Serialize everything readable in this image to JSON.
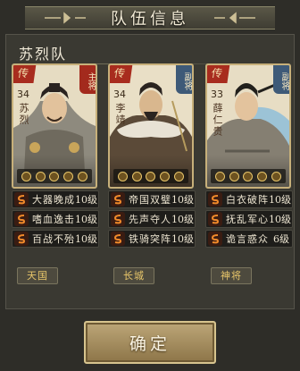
{
  "header": {
    "title": "队伍信息"
  },
  "team": {
    "name": "苏烈队"
  },
  "generals": [
    {
      "seal": "传",
      "rank": "主将",
      "level": "34",
      "name": "苏烈",
      "skills": [
        {
          "name": "大器晚成",
          "level": "10级"
        },
        {
          "name": "嗜血逸击",
          "level": "10级"
        },
        {
          "name": "百战不殆",
          "level": "10级"
        }
      ],
      "tag": "天国"
    },
    {
      "seal": "传",
      "rank": "副将",
      "level": "34",
      "name": "李靖",
      "skills": [
        {
          "name": "帝国双璧",
          "level": "10级"
        },
        {
          "name": "先声夺人",
          "level": "10级"
        },
        {
          "name": "铁骑突阵",
          "level": "10级"
        }
      ],
      "tag": "长城"
    },
    {
      "seal": "传",
      "rank": "副将",
      "level": "33",
      "name": "薛仁贵",
      "skills": [
        {
          "name": "白衣破阵",
          "level": "10级"
        },
        {
          "name": "抚乱军心",
          "level": "10级"
        },
        {
          "name": "诡言惑众",
          "level": "6级"
        }
      ],
      "tag": "神将"
    }
  ],
  "confirm_label": "确定",
  "colors": {
    "accent": "#e8c66a",
    "main_rank": "#a32a1d",
    "vice_rank": "#3e5a78"
  }
}
